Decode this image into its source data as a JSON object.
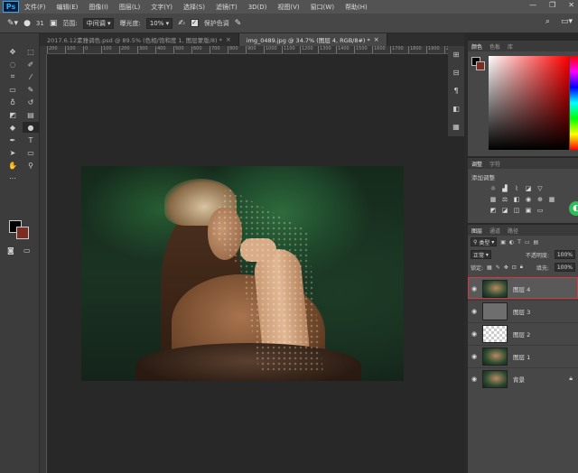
{
  "app": {
    "logo": "Ps"
  },
  "menu": [
    "文件(F)",
    "编辑(E)",
    "图像(I)",
    "图层(L)",
    "文字(Y)",
    "选择(S)",
    "滤镜(T)",
    "3D(D)",
    "视图(V)",
    "窗口(W)",
    "帮助(H)"
  ],
  "window_controls": {
    "minimize": "—",
    "restore": "❐",
    "close": "✕"
  },
  "options": {
    "brush_size": "31",
    "range_label": "范围:",
    "range_value": "中间调",
    "exposure_label": "曝光度:",
    "exposure_value": "10%",
    "protect_tones_label": "保护色调"
  },
  "tabs": [
    {
      "title": "2017.6.12素雅调色.psd @ 89.5% (色相/饱和度 1, 图层蒙版/8) *",
      "close": "×"
    },
    {
      "title": "img_0489.jpg @ 34.7% (图层 4, RGB/8#) *",
      "close": "×"
    }
  ],
  "ruler_ticks": [
    "200",
    "100",
    "0",
    "100",
    "200",
    "300",
    "400",
    "500",
    "600",
    "700",
    "800",
    "900",
    "1000",
    "1100",
    "1200",
    "1300",
    "1400",
    "1500",
    "1600",
    "1700",
    "1800",
    "1900",
    "2000"
  ],
  "panels": {
    "color_tabs": [
      "颜色",
      "色板",
      "库"
    ],
    "adjust_tabs": [
      "调整",
      "字符"
    ],
    "adjust_title": "添加调整",
    "layers_tabs": [
      "图层",
      "通道",
      "路径"
    ],
    "filter_kind": "类型",
    "blend_mode": "正常",
    "opacity_label": "不透明度:",
    "opacity_value": "100%",
    "lock_label": "锁定:",
    "fill_label": "填充:",
    "fill_value": "100%"
  },
  "layers": [
    {
      "name": "图层 4",
      "thumb": "photo",
      "selected": true
    },
    {
      "name": "图层 3",
      "thumb": "gray",
      "selected": false
    },
    {
      "name": "图层 2",
      "thumb": "checker",
      "selected": false
    },
    {
      "name": "图层 1",
      "thumb": "photo",
      "selected": false
    },
    {
      "name": "背景",
      "thumb": "photo",
      "selected": false,
      "locked": true
    }
  ],
  "colors": {
    "foreground": "#000000",
    "background": "#7c2d22",
    "accent_red": "#d9363e",
    "adjust_green": "#2fbf5a"
  }
}
